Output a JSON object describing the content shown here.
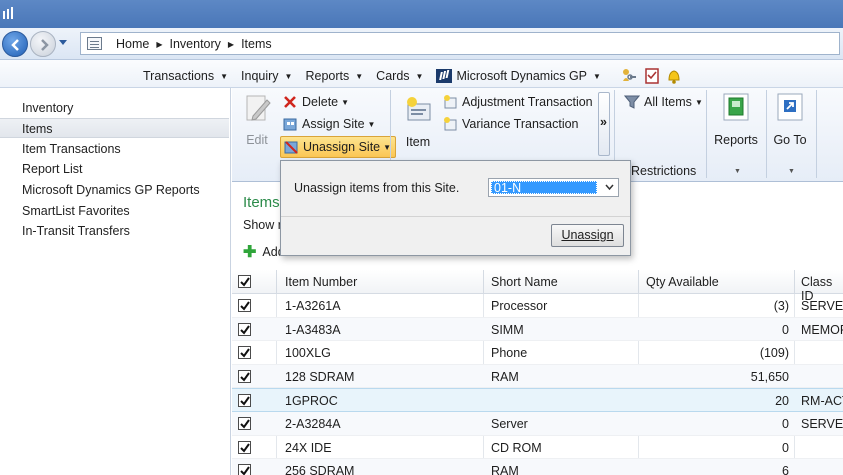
{
  "address": {
    "breadcrumbs": [
      "Home",
      "Inventory",
      "Items"
    ]
  },
  "menubar": {
    "items": [
      {
        "label": "Transactions"
      },
      {
        "label": "Inquiry"
      },
      {
        "label": "Reports"
      },
      {
        "label": "Cards"
      },
      {
        "label": "Microsoft Dynamics GP"
      }
    ]
  },
  "leftnav": {
    "items": [
      {
        "label": "Inventory",
        "selected": false
      },
      {
        "label": "Items",
        "selected": true
      },
      {
        "label": "Item Transactions",
        "selected": false
      },
      {
        "label": "Report List",
        "selected": false
      },
      {
        "label": "Microsoft Dynamics GP Reports",
        "selected": false
      },
      {
        "label": "SmartList Favorites",
        "selected": false
      },
      {
        "label": "In-Transit Transfers",
        "selected": false
      }
    ]
  },
  "ribbon": {
    "edit": "Edit",
    "delete": "Delete",
    "assign_site": "Assign Site",
    "unassign_site": "Unassign Site",
    "item": "Item",
    "adjustment_transaction": "Adjustment Transaction",
    "variance_transaction": "Variance Transaction",
    "more": "»",
    "all_items": "All Items",
    "restrictions": "Restrictions",
    "reports": "Reports",
    "go_to": "Go To"
  },
  "content": {
    "title": "Items",
    "show_prefix": "Show r",
    "add_prefix": "Add"
  },
  "popup": {
    "label": "Unassign items from this Site.",
    "site_value": "01-N",
    "button": "Unassign"
  },
  "table": {
    "columns": [
      "Item Number",
      "Short Name",
      "Qty Available",
      "Class ID"
    ],
    "rows": [
      {
        "item": "1-A3261A",
        "short": "Processor",
        "qty": "(3)",
        "class": "SERVERS",
        "checked": true
      },
      {
        "item": "1-A3483A",
        "short": "SIMM",
        "qty": "0",
        "class": "MEMORY",
        "checked": true
      },
      {
        "item": "100XLG",
        "short": "Phone",
        "qty": "(109)",
        "class": "",
        "checked": true
      },
      {
        "item": "128 SDRAM",
        "short": "RAM",
        "qty": "51,650",
        "class": "",
        "checked": true
      },
      {
        "item": "1GPROC",
        "short": "",
        "qty": "20",
        "class": "RM-ACT",
        "checked": true
      },
      {
        "item": "2-A3284A",
        "short": "Server",
        "qty": "0",
        "class": "SERVERS",
        "checked": true
      },
      {
        "item": "24X IDE",
        "short": "CD ROM",
        "qty": "0",
        "class": "",
        "checked": true
      },
      {
        "item": "256 SDRAM",
        "short": "RAM",
        "qty": "6",
        "class": "",
        "checked": true
      }
    ]
  },
  "colors": {
    "title_green": "#2c8b4a",
    "selection_blue": "#3399ff",
    "ribbon_highlight": "#fbc654",
    "titlebar": "#4a77b8"
  }
}
